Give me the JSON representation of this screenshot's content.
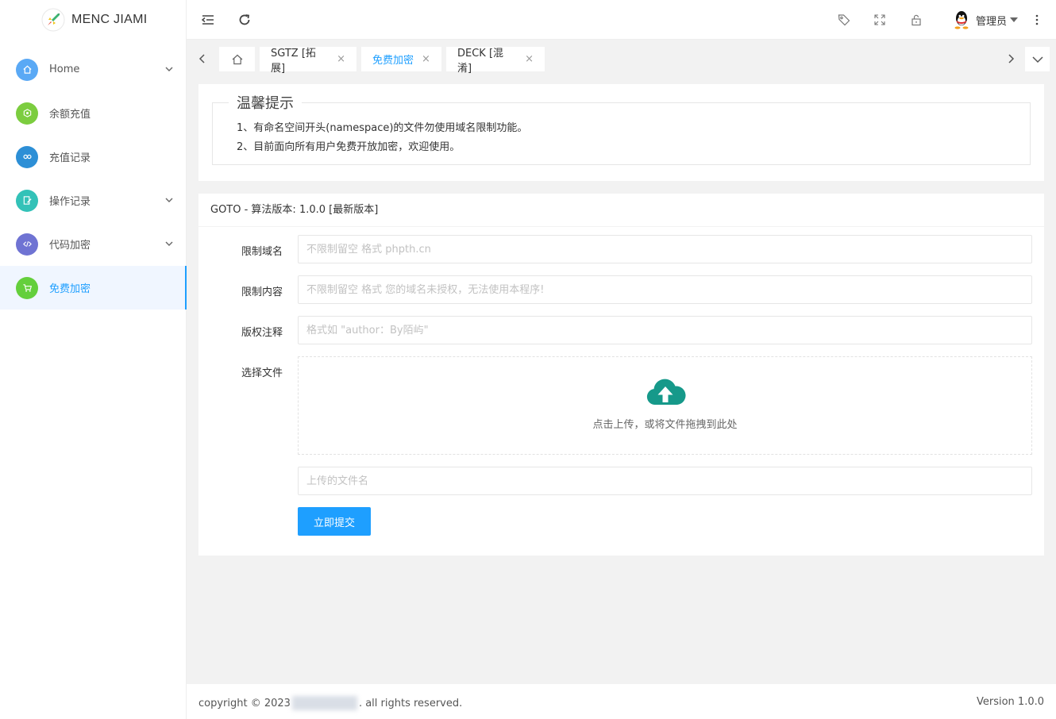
{
  "app": {
    "title": "MENC JIAMI"
  },
  "sidebar": {
    "items": [
      {
        "label": "Home",
        "icon": "home-icon",
        "color": "#5aa9f5",
        "has_children": true
      },
      {
        "label": "余额充值",
        "icon": "wallet-icon",
        "color": "#7ccd3f",
        "has_children": false
      },
      {
        "label": "充值记录",
        "icon": "link-icon",
        "color": "#2d8fd6",
        "has_children": false
      },
      {
        "label": "操作记录",
        "icon": "edit-icon",
        "color": "#33c2b8",
        "has_children": true
      },
      {
        "label": "代码加密",
        "icon": "code-icon",
        "color": "#6f73d3",
        "has_children": true
      },
      {
        "label": "免费加密",
        "icon": "cart-icon",
        "color": "#64cf3c",
        "has_children": false
      }
    ],
    "active_index": 5
  },
  "header": {
    "user_name": "管理员"
  },
  "tabs": [
    {
      "label": "SGTZ [拓展]",
      "active": false
    },
    {
      "label": "免费加密",
      "active": true
    },
    {
      "label": "DECK [混淆]",
      "active": false
    }
  ],
  "tab_close_glyph": "×",
  "notice": {
    "title": "温馨提示",
    "lines": [
      "1、有命名空间开头(namespace)的文件勿使用域名限制功能。",
      "2、目前面向所有用户免费开放加密，欢迎使用。"
    ]
  },
  "form": {
    "title": "GOTO - 算法版本: 1.0.0 [最新版本]",
    "fields": {
      "domain": {
        "label": "限制域名",
        "placeholder": "不限制留空 格式 phpth.cn",
        "value": ""
      },
      "content": {
        "label": "限制内容",
        "placeholder": "不限制留空 格式 您的域名未授权，无法使用本程序!",
        "value": ""
      },
      "copyright": {
        "label": "版权注释",
        "placeholder": "格式如 \"author：By陌屿\"",
        "value": ""
      },
      "file": {
        "label": "选择文件"
      },
      "filename": {
        "placeholder": "上传的文件名",
        "value": ""
      }
    },
    "upload_text": "点击上传，或将文件拖拽到此处",
    "submit_label": "立即提交"
  },
  "footer": {
    "copyright_prefix": "copyright © 2023",
    "copyright_suffix": ". all rights reserved.",
    "version": "Version 1.0.0"
  },
  "colors": {
    "accent": "#1e9fff",
    "upload_icon": "#16998a",
    "bg": "#f2f2f2"
  }
}
